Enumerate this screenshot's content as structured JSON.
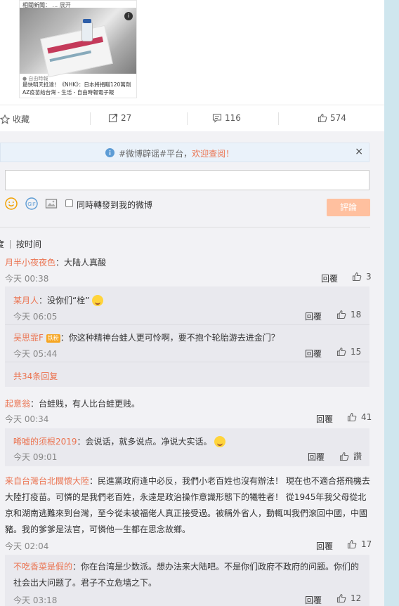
{
  "article": {
    "caption": "相關新聞：",
    "more": "... 展开",
    "source": "自由時報",
    "headline": "最快明天抵達！《NHK》：日本將捐贈120萬劑AZ疫苗給台灣 - 生活 - 自由時報電子報"
  },
  "actions": {
    "favorite": "收藏",
    "repost_count": "27",
    "comment_count": "116",
    "like_count": "574"
  },
  "notice": {
    "text": "#微博辟谣#平台，",
    "link": "欢迎查阅！",
    "close": "×"
  },
  "composer": {
    "also_repost": "同時轉發到我的微博",
    "submit": "評論"
  },
  "sort": {
    "partial": "度",
    "by_time": "按时间"
  },
  "labels": {
    "reply": "回覆",
    "like_word": "讚",
    "more_replies": "共34条回复"
  },
  "comments": [
    {
      "nick": "月半小夜夜色",
      "text": "：大陆人真酸",
      "time": "今天 00:38",
      "likes": "3"
    },
    {
      "nick": "某月人",
      "text": "：没你们“栓”",
      "time": "今天 06:05",
      "likes": "18"
    },
    {
      "nick": "吴思霏F",
      "badge": "铁粉",
      "text": "：你这种精神台蛙人更可怜啊，要不抱个轮胎游去进金门？",
      "time": "今天 05:44",
      "likes": "15"
    },
    {
      "nick": "起意翁",
      "text": "：台蛙贱，有人比台蛙更贱。",
      "time": "今天 00:34",
      "likes": "41"
    },
    {
      "nick": "唏嘘的须根2019",
      "text": "：会说话，就多说点。净说大实话。",
      "time": "今天 09:01"
    },
    {
      "nick": "来自台灣台北關懷大陸",
      "line1": "：民進黨政府逢中必反，我們小老百姓也沒有辦法！ 現在也不適合搭飛機去",
      "line2": "大陸打疫苗。可憐的是我們老百姓，永遠是政治操作意識形態下的犧牲者！ 從1945年我父母從北",
      "line3": "京和湖南逃難來到台灣，至今從未被福佬人真正接受過。被稱外省人，動輒叫我們滾回中國，中國",
      "line4": "豬。我的爹爹是法官，可憐他一生都在思念故鄉。",
      "time": "今天 02:04",
      "likes": "17"
    },
    {
      "nick": "不吃香菜是假的",
      "line1": "：你在台湾是少数派。想办法来大陆吧。不是你们政府不政府的问题。你们的",
      "line2": "社会出大问题了。君子不立危墙之下。",
      "time": "今天 03:18",
      "likes": "12"
    }
  ]
}
